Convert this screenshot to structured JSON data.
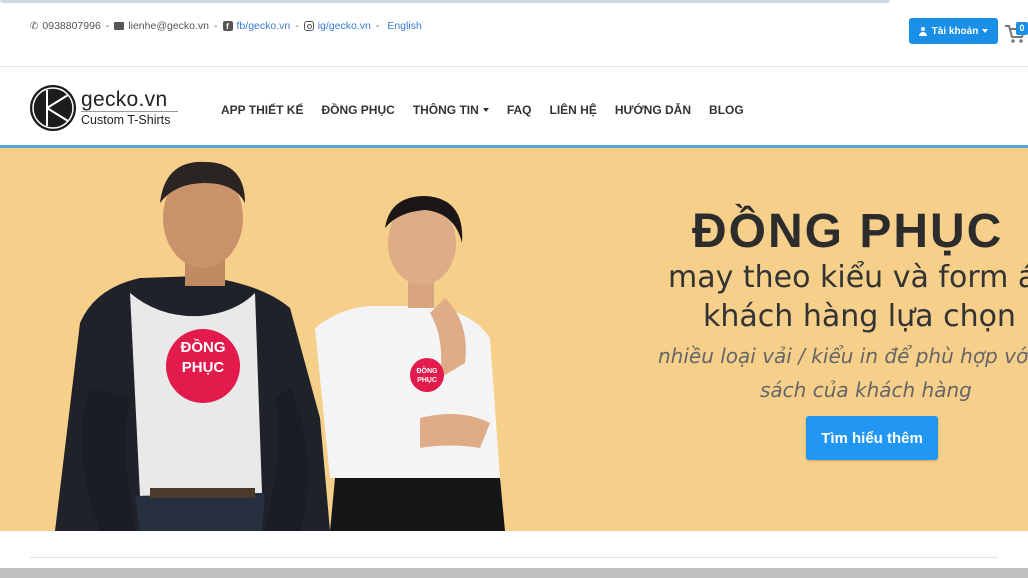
{
  "contact": {
    "phone_icon": "phone-icon",
    "phone": "0938807996",
    "sep": "-",
    "email_icon": "mail-icon",
    "email": "lienhe@gecko.vn",
    "facebook_icon": "facebook-icon",
    "facebook": "fb/gecko.vn",
    "instagram_icon": "instagram-icon",
    "instagram": "ig/gecko.vn",
    "language": "English"
  },
  "account": {
    "label": "Tài khoản",
    "icon": "user-icon"
  },
  "cart": {
    "icon": "cart-icon",
    "count": "0"
  },
  "logo": {
    "name": "gecko.vn",
    "tagline": "Custom T-Shirts"
  },
  "nav": {
    "items": [
      {
        "label": "APP THIẾT KẾ"
      },
      {
        "label": "ĐỒNG PHỤC"
      },
      {
        "label": "THÔNG TIN"
      },
      {
        "label": "FAQ"
      },
      {
        "label": "LIÊN HỆ"
      },
      {
        "label": "HƯỚNG DẪN"
      },
      {
        "label": "BLOG"
      }
    ]
  },
  "hero": {
    "title": "ĐỒNG PHỤC",
    "subtitle_line1": "may theo kiểu và form á",
    "subtitle_line2": "khách hàng lựa chọn",
    "desc_line1": "nhiều loại vải / kiểu in để phù hợp với ng",
    "desc_line2": "sách của khách hàng",
    "cta": "Tìm hiểu thêm",
    "shirt_print_line1": "ĐỒNG",
    "shirt_print_line2": "PHỤC"
  },
  "colors": {
    "accent": "#1a8fe8",
    "hero_bg": "#f6cf8a",
    "nav_accent": "#5aa5d6",
    "shirt_badge": "#e31b4c"
  }
}
